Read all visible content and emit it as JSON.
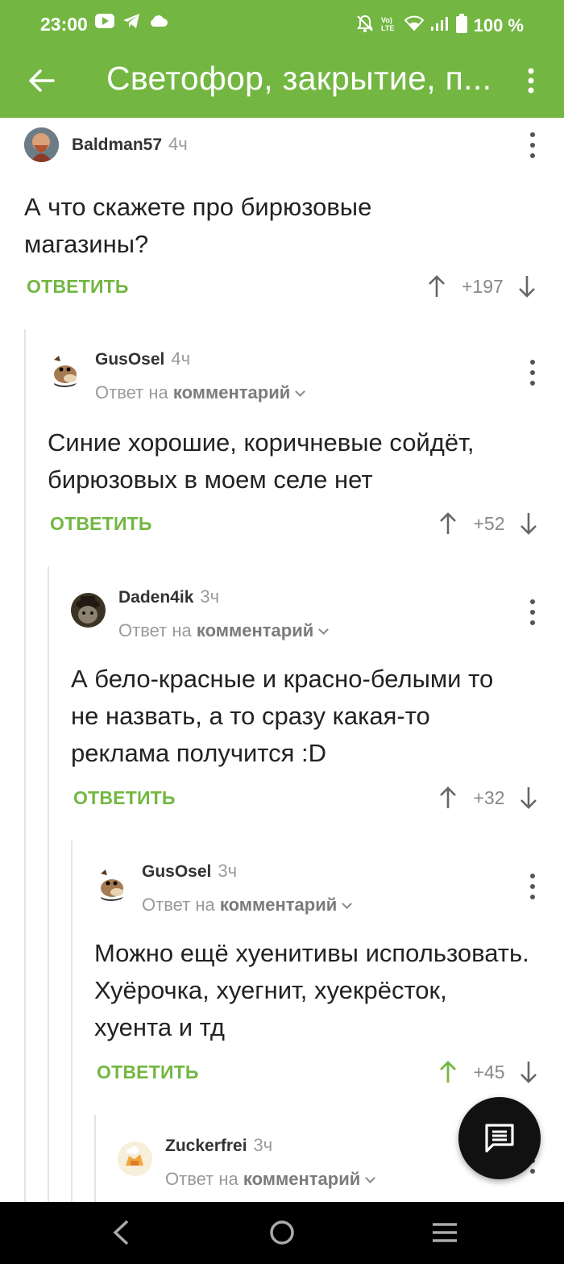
{
  "status_bar": {
    "time": "23:00",
    "battery": "100 %",
    "left_icons": [
      "youtube-icon",
      "telegram-icon",
      "cloud-icon"
    ],
    "right_icons": [
      "bell-off-icon",
      "volte-icon",
      "wifi-icon",
      "signal-icon",
      "battery-icon"
    ]
  },
  "app_bar": {
    "title": "Светофор, закрытие, п...",
    "accent": "#73b742"
  },
  "comments": [
    {
      "author": "Baldman57",
      "time": "4ч",
      "reply_prefix": "",
      "reply_target": "",
      "text": "А что скажете про бирюзовые магазины?",
      "reply_label": "ОТВЕТИТЬ",
      "score": "+197",
      "upvoted": false
    },
    {
      "author": "GusOsel",
      "time": "4ч",
      "reply_prefix": "Ответ на",
      "reply_target": "комментарий",
      "text": "Синие хорошие, коричневые сойдёт, бирюзовых в моем селе нет",
      "reply_label": "ОТВЕТИТЬ",
      "score": "+52",
      "upvoted": false
    },
    {
      "author": "Daden4ik",
      "time": "3ч",
      "reply_prefix": "Ответ на",
      "reply_target": "комментарий",
      "text": "А бело-красные и красно-белыми то не назвать, а то сразу какая-то реклама получится :D",
      "reply_label": "ОТВЕТИТЬ",
      "score": "+32",
      "upvoted": false
    },
    {
      "author": "GusOsel",
      "time": "3ч",
      "reply_prefix": "Ответ на",
      "reply_target": "комментарий",
      "text": "Можно ещё хуенитивы использовать. Хуёрочка, хуегнит, хуекрёсток, хуента и тд",
      "reply_label": "ОТВЕТИТЬ",
      "score": "+45",
      "upvoted": true
    },
    {
      "author": "Zuckerfrei",
      "time": "3ч",
      "reply_prefix": "Ответ на",
      "reply_target": "комментарий",
      "text": "",
      "reply_label": "",
      "score": "",
      "upvoted": false
    }
  ],
  "fab": {
    "icon": "comment-icon"
  },
  "nav_bar": {
    "icons": [
      "back-nav-icon",
      "home-nav-icon",
      "recents-nav-icon"
    ]
  }
}
